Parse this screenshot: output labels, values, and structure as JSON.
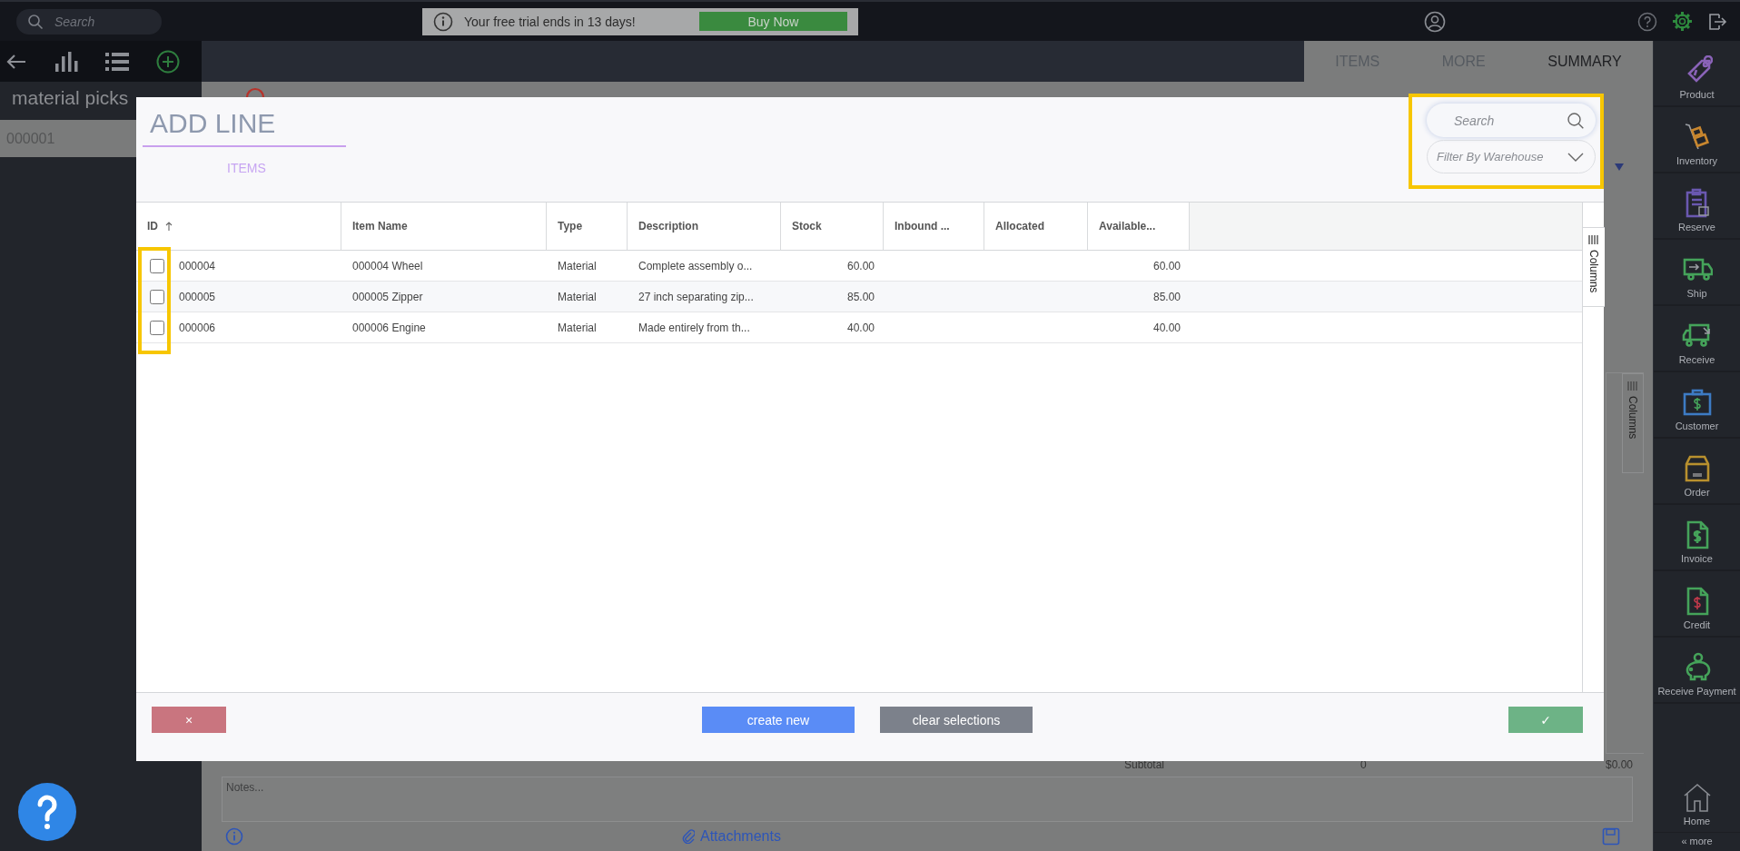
{
  "top_bar": {
    "search": {
      "placeholder": "Search"
    },
    "trial_banner": {
      "text": "Your free trial ends in 13 days!",
      "button": "Buy Now"
    }
  },
  "left_panel": {
    "title": "material picks",
    "rows": [
      {
        "label": "000001",
        "selected": true
      }
    ]
  },
  "main_tabs": [
    {
      "label": "ITEMS",
      "selected": false
    },
    {
      "label": "MORE",
      "selected": false
    },
    {
      "label": "SUMMARY",
      "selected": true
    }
  ],
  "background_form": {
    "columns_tab": "Columns",
    "subtotal_label": "Subtotal",
    "subtotal_qty": "0",
    "subtotal_amount": "$0.00",
    "notes": {
      "placeholder": "Notes..."
    },
    "attachments": "Attachments"
  },
  "dialog": {
    "title": "ADD LINE",
    "tabs": [
      {
        "label": "ITEMS",
        "selected": true
      }
    ],
    "search": {
      "placeholder": "Search"
    },
    "filter": {
      "placeholder": "Filter By Warehouse"
    },
    "table": {
      "columns": [
        {
          "label": "ID",
          "kind": "text",
          "sorted_ascending": true
        },
        {
          "label": "Item Name",
          "kind": "text"
        },
        {
          "label": "Type",
          "kind": "text"
        },
        {
          "label": "Description",
          "kind": "text"
        },
        {
          "label": "Stock",
          "kind": "number"
        },
        {
          "label": "Inbound ...",
          "kind": "number"
        },
        {
          "label": "Allocated",
          "kind": "number"
        },
        {
          "label": "Available...",
          "kind": "number"
        }
      ],
      "rows": [
        {
          "checked": false,
          "cells": [
            "000004",
            "000004 Wheel",
            "Material",
            "Complete assembly o...",
            "60.00",
            "",
            "",
            "60.00"
          ]
        },
        {
          "checked": false,
          "cells": [
            "000005",
            "000005 Zipper",
            "Material",
            "27 inch separating zip...",
            "85.00",
            "",
            "",
            "85.00"
          ]
        },
        {
          "checked": false,
          "cells": [
            "000006",
            "000006 Engine",
            "Material",
            "Made entirely from th...",
            "40.00",
            "",
            "",
            "40.00"
          ]
        }
      ]
    },
    "columns_tab": "Columns",
    "buttons": [
      {
        "kind": "cancel",
        "label": "×"
      },
      {
        "kind": "create",
        "label": "create new"
      },
      {
        "kind": "clear",
        "label": "clear selections"
      },
      {
        "kind": "confirm",
        "label": "✓"
      }
    ],
    "highlight_search_panel": true,
    "highlight_checkbox_column": true
  },
  "right_sidebar": {
    "items": [
      {
        "kind": "product",
        "label": "Product",
        "color": "#8a63b8"
      },
      {
        "kind": "inventory",
        "label": "Inventory",
        "color": "#c8862e"
      },
      {
        "kind": "reserve",
        "label": "Reserve",
        "color": "#6a58b0"
      },
      {
        "kind": "ship",
        "label": "Ship",
        "color": "#45a35a"
      },
      {
        "kind": "receive",
        "label": "Receive",
        "color": "#45a35a"
      },
      {
        "kind": "customer",
        "label": "Customer",
        "color": "#3d7bc4"
      },
      {
        "kind": "order",
        "label": "Order",
        "color": "#b8902e"
      },
      {
        "kind": "invoice",
        "label": "Invoice",
        "color": "#45a35a"
      },
      {
        "kind": "credit",
        "label": "Credit",
        "color": "#45a35a"
      },
      {
        "kind": "payment",
        "label": "Receive Payment",
        "color": "#45a35a"
      }
    ],
    "home": "Home",
    "more": "« more"
  }
}
